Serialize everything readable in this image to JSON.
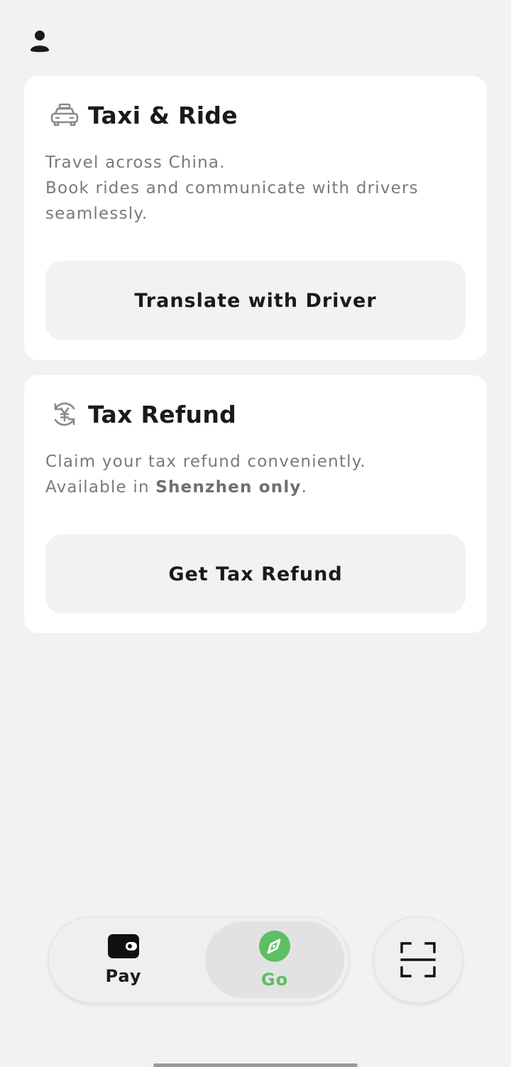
{
  "header": {
    "profile_icon": "person-icon"
  },
  "cards": {
    "taxi": {
      "icon": "taxi-icon",
      "title": "Taxi & Ride",
      "desc_line1": "Travel across China.",
      "desc_line2": "Book rides and communicate with drivers seamlessly.",
      "button_label": "Translate with Driver"
    },
    "refund": {
      "icon": "yuan-refund-icon",
      "title": "Tax Refund",
      "desc_line1": "Claim your tax refund conveniently.",
      "desc_prefix": "Available in ",
      "desc_strong": "Shenzhen only",
      "desc_suffix": ".",
      "button_label": "Get Tax Refund"
    }
  },
  "tabbar": {
    "pay": {
      "label": "Pay",
      "icon": "wallet-icon"
    },
    "go": {
      "label": "Go",
      "icon": "compass-icon",
      "active": true
    }
  },
  "scan": {
    "icon": "scan-icon"
  },
  "colors": {
    "background": "#f2f2f2",
    "card": "#ffffff",
    "accent_green": "#5cbf62",
    "text_primary": "#1a1a1a",
    "text_secondary": "#7a7a7a"
  }
}
